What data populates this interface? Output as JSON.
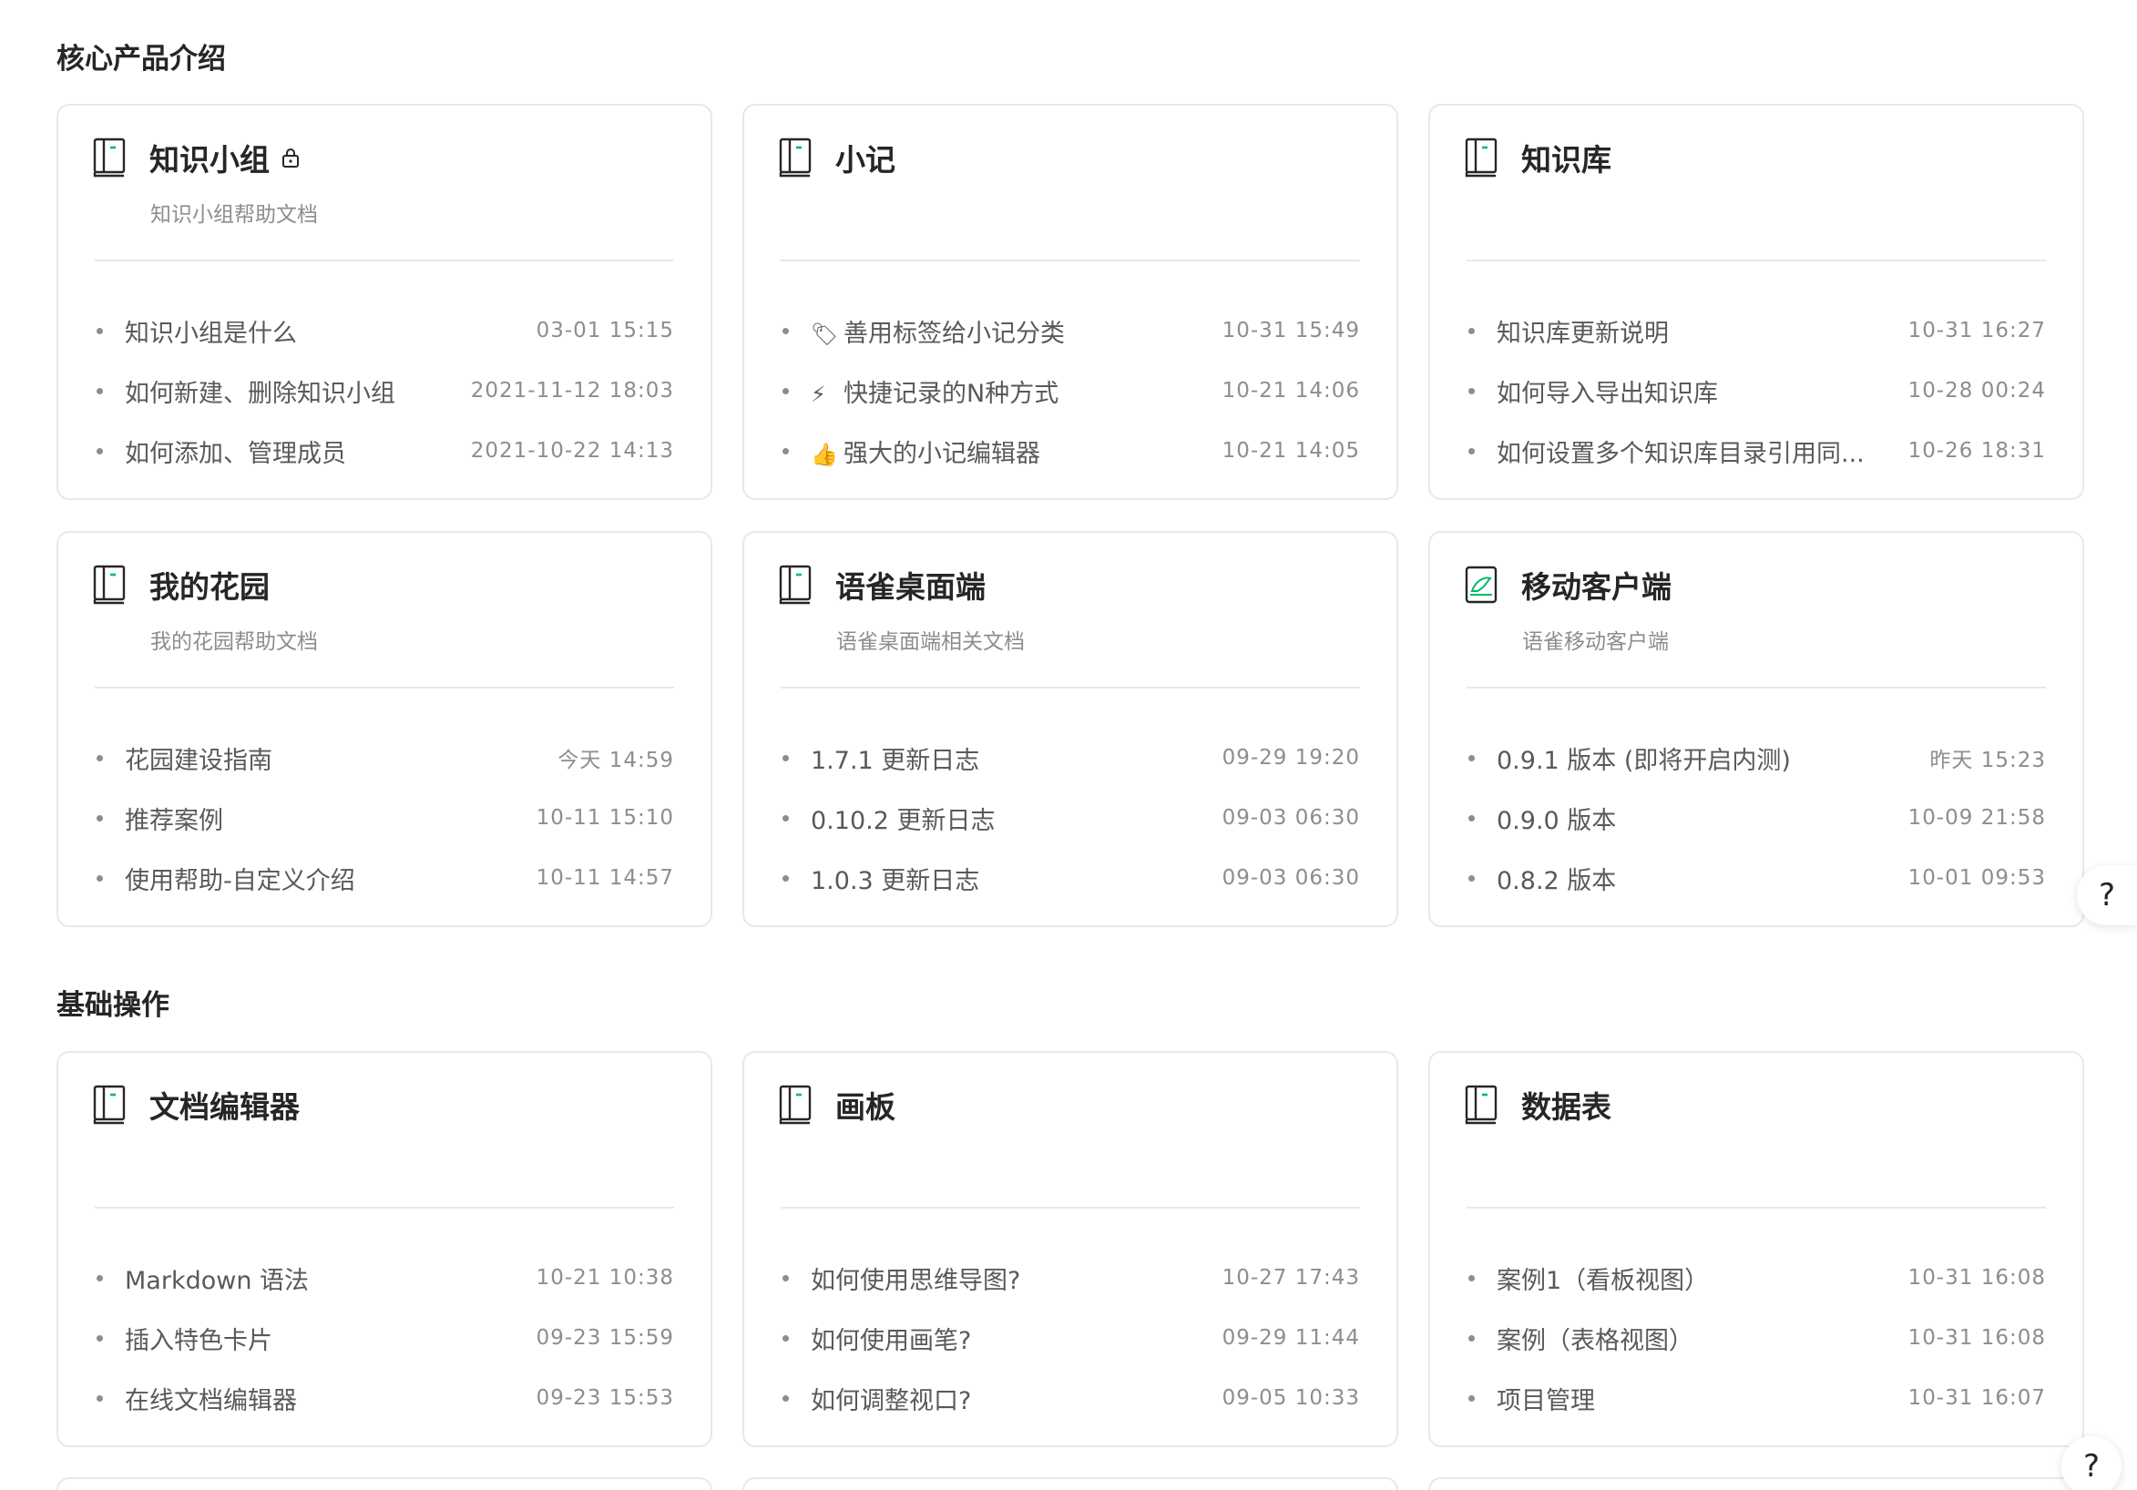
{
  "sections": [
    {
      "title": "核心产品介绍",
      "cards": [
        {
          "title": "知识小组",
          "locked": true,
          "subtitle": "知识小组帮助文档",
          "icon": "book-icon",
          "docs": [
            {
              "title": "知识小组是什么",
              "emoji": "",
              "time": "03-01 15:15"
            },
            {
              "title": "如何新建、删除知识小组",
              "emoji": "",
              "time": "2021-11-12 18:03"
            },
            {
              "title": "如何添加、管理成员",
              "emoji": "",
              "time": "2021-10-22 14:13"
            }
          ]
        },
        {
          "title": "小记",
          "locked": false,
          "subtitle": "",
          "icon": "book-icon",
          "docs": [
            {
              "title": "善用标签给小记分类",
              "emoji": "🏷",
              "time": "10-31 15:49"
            },
            {
              "title": "快捷记录的N种方式",
              "emoji": "⚡",
              "time": "10-21 14:06"
            },
            {
              "title": "强大的小记编辑器",
              "emoji": "👍",
              "time": "10-21 14:05"
            }
          ]
        },
        {
          "title": "知识库",
          "locked": false,
          "subtitle": "",
          "icon": "book-icon",
          "docs": [
            {
              "title": "知识库更新说明",
              "emoji": "",
              "time": "10-31 16:27"
            },
            {
              "title": "如何导入导出知识库",
              "emoji": "",
              "time": "10-28 00:24"
            },
            {
              "title": "如何设置多个知识库目录引用同...",
              "emoji": "",
              "time": "10-26 18:31"
            }
          ]
        },
        {
          "title": "我的花园",
          "locked": false,
          "subtitle": "我的花园帮助文档",
          "icon": "book-icon",
          "docs": [
            {
              "title": "花园建设指南",
              "emoji": "",
              "time": "今天 14:59"
            },
            {
              "title": "推荐案例",
              "emoji": "",
              "time": "10-11 15:10"
            },
            {
              "title": "使用帮助-自定义介绍",
              "emoji": "",
              "time": "10-11 14:57"
            }
          ]
        },
        {
          "title": "语雀桌面端",
          "locked": false,
          "subtitle": "语雀桌面端相关文档",
          "icon": "book-icon",
          "docs": [
            {
              "title": "1.7.1 更新日志",
              "emoji": "",
              "time": "09-29 19:20"
            },
            {
              "title": "0.10.2 更新日志",
              "emoji": "",
              "time": "09-03 06:30"
            },
            {
              "title": "1.0.3 更新日志",
              "emoji": "",
              "time": "09-03 06:30"
            }
          ]
        },
        {
          "title": "移动客户端",
          "locked": false,
          "subtitle": "语雀移动客户端",
          "icon": "bird-icon",
          "docs": [
            {
              "title": "0.9.1 版本 (即将开启内测)",
              "emoji": "",
              "time": "昨天 15:23"
            },
            {
              "title": "0.9.0 版本",
              "emoji": "",
              "time": "10-09 21:58"
            },
            {
              "title": "0.8.2 版本",
              "emoji": "",
              "time": "10-01 09:53"
            }
          ]
        }
      ]
    },
    {
      "title": "基础操作",
      "cards": [
        {
          "title": "文档编辑器",
          "locked": false,
          "subtitle": "",
          "icon": "book-icon",
          "docs": [
            {
              "title": "Markdown 语法",
              "emoji": "",
              "time": "10-21 10:38"
            },
            {
              "title": "插入特色卡片",
              "emoji": "",
              "time": "09-23 15:59"
            },
            {
              "title": "在线文档编辑器",
              "emoji": "",
              "time": "09-23 15:53"
            }
          ]
        },
        {
          "title": "画板",
          "locked": false,
          "subtitle": "",
          "icon": "book-icon",
          "docs": [
            {
              "title": "如何使用思维导图?",
              "emoji": "",
              "time": "10-27 17:43"
            },
            {
              "title": "如何使用画笔?",
              "emoji": "",
              "time": "09-29 11:44"
            },
            {
              "title": "如何调整视口?",
              "emoji": "",
              "time": "09-05 10:33"
            }
          ]
        },
        {
          "title": "数据表",
          "locked": false,
          "subtitle": "",
          "icon": "book-icon",
          "docs": [
            {
              "title": "案例1（看板视图）",
              "emoji": "",
              "time": "10-31 16:08"
            },
            {
              "title": "案例（表格视图）",
              "emoji": "",
              "time": "10-31 16:08"
            },
            {
              "title": "项目管理",
              "emoji": "",
              "time": "10-31 16:07"
            }
          ]
        }
      ]
    }
  ],
  "help_button": {
    "label": "?"
  },
  "colors": {
    "border": "#e7e9e8",
    "title": "#262626",
    "doc_text": "#585a5a",
    "muted": "#8a8f8d",
    "accent_green": "#00b96b"
  }
}
